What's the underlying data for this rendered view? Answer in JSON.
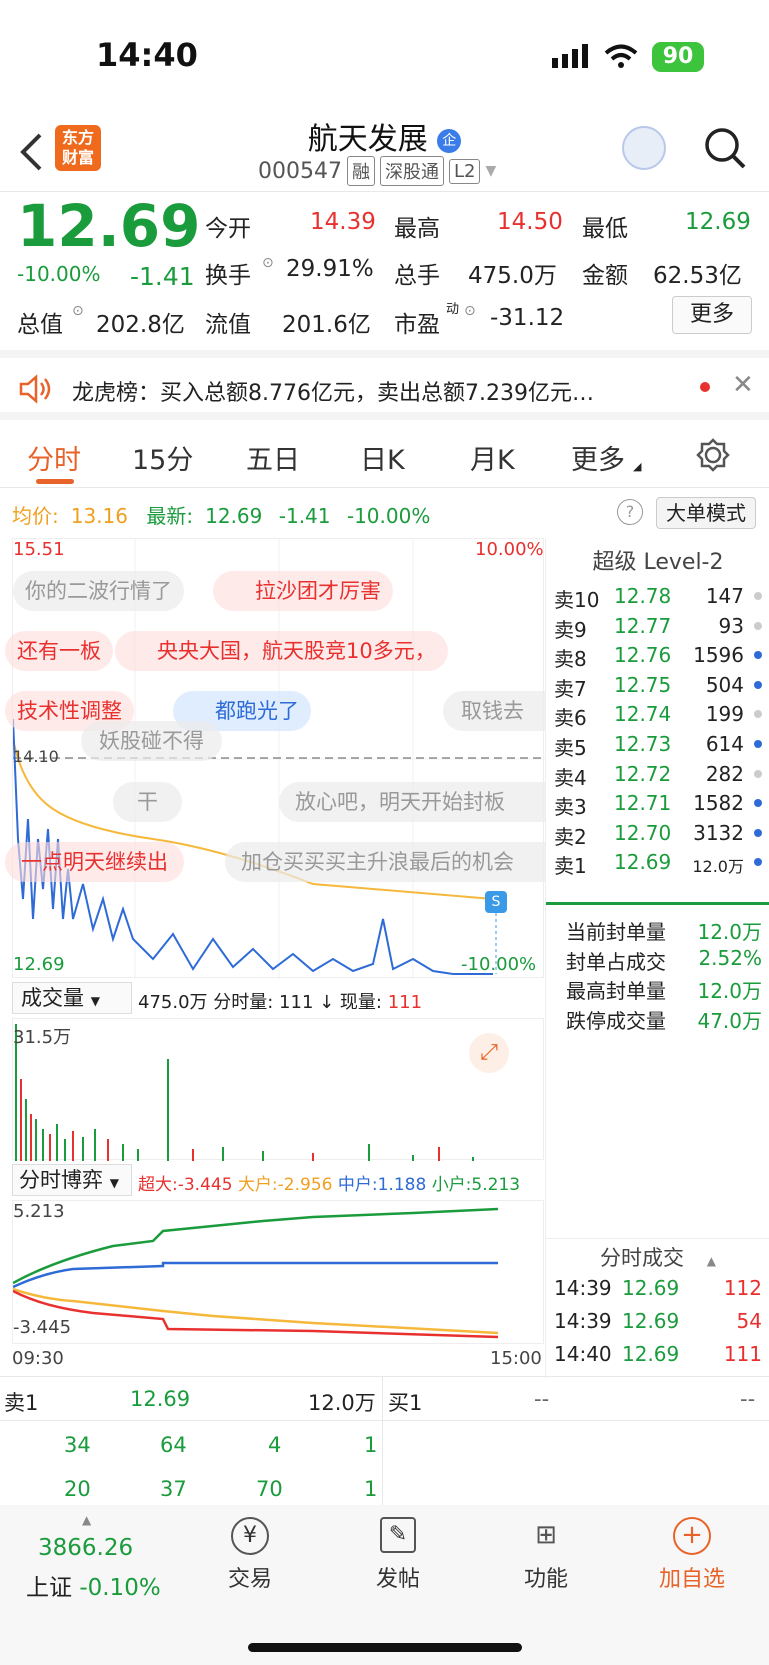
{
  "status": {
    "time": "14:40",
    "battery": "90"
  },
  "header": {
    "logo": "东方\n财富",
    "title": "航天发展",
    "code": "000547",
    "tags": [
      "融",
      "深股通",
      "L2"
    ]
  },
  "quote": {
    "price": "12.69",
    "pct": "-10.00%",
    "chg": "-1.41",
    "fields": [
      [
        "今开",
        "14.39"
      ],
      [
        "最高",
        "14.50"
      ],
      [
        "最低",
        "12.69"
      ],
      [
        "换手",
        "29.91%"
      ],
      [
        "总手",
        "475.0万"
      ],
      [
        "金额",
        "62.53亿"
      ],
      [
        "总值",
        "202.8亿"
      ],
      [
        "流值",
        "201.6亿"
      ],
      [
        "市盈",
        "-31.12"
      ]
    ],
    "more_btn": "更多"
  },
  "notice": "龙虎榜：买入总额8.776亿元，卖出总额7.239亿元…",
  "tabs": [
    "分时",
    "15分",
    "五日",
    "日K",
    "月K",
    "更多"
  ],
  "chart": {
    "avg_label": "均价:",
    "avg": "13.16",
    "latest_label": "最新:",
    "latest": "12.69",
    "latest_chg": "-1.41",
    "latest_pct": "-10.00%",
    "mode_btn": "大单模式",
    "top_price": "15.51",
    "top_pct": "10.00%",
    "bottom_price": "12.69",
    "bottom_pct": "-10.00%",
    "ref_price": "14.10",
    "danmu": [
      "你的二波行情了",
      "拉沙团才厉害",
      "还有一板",
      "央央大国，航天股竞10多元，",
      "技术性调整",
      "都跑光了",
      "取钱去",
      "妖股碰不得",
      "干",
      "放心吧，明天开始封板",
      "一点明天继续出",
      "加仓买买买主升浪最后的机会"
    ],
    "vol_selector": "成交量",
    "vol_info": "475.0万 分时量: 111 ↓ 现量:",
    "vol_now": "111",
    "vol_max": "31.5万",
    "bo_selector": "分时博弈",
    "bo_super": "超大:-3.445",
    "bo_big": "大户:-2.956",
    "bo_mid": "中户:1.188",
    "bo_small": "小户:5.213",
    "bo_top": "5.213",
    "bo_bottom": "-3.445",
    "t_start": "09:30",
    "t_end": "15:00"
  },
  "level2": {
    "title": "超级 Level-2",
    "rows": [
      [
        "卖10",
        "12.78",
        "147"
      ],
      [
        "卖9",
        "12.77",
        "93"
      ],
      [
        "卖8",
        "12.76",
        "1596"
      ],
      [
        "卖7",
        "12.75",
        "504"
      ],
      [
        "卖6",
        "12.74",
        "199"
      ],
      [
        "卖5",
        "12.73",
        "614"
      ],
      [
        "卖4",
        "12.72",
        "282"
      ],
      [
        "卖3",
        "12.71",
        "1582"
      ],
      [
        "卖2",
        "12.70",
        "3132"
      ],
      [
        "卖1",
        "12.69",
        "12.0万"
      ]
    ],
    "stats": [
      [
        "当前封单量",
        "12.0万"
      ],
      [
        "封单占成交",
        "2.52%"
      ],
      [
        "最高封单量",
        "12.0万"
      ],
      [
        "跌停成交量",
        "47.0万"
      ]
    ],
    "trades_title": "分时成交",
    "trades": [
      [
        "14:39",
        "12.69",
        "112"
      ],
      [
        "14:39",
        "12.69",
        "54"
      ],
      [
        "14:40",
        "12.69",
        "111"
      ]
    ]
  },
  "order": {
    "sell1": "卖1",
    "sell1_price": "12.69",
    "sell1_vol": "12.0万",
    "buy1": "买1",
    "buy1_price": "--",
    "buy1_vol": "--",
    "q1": [
      "34",
      "64",
      "4",
      "1"
    ],
    "q2": [
      "20",
      "37",
      "70",
      "1"
    ]
  },
  "bottom": {
    "index_val": "3866.26",
    "index_name": "上证",
    "index_pct": "-0.10%",
    "items": [
      "交易",
      "发帖",
      "功能",
      "加自选"
    ]
  }
}
